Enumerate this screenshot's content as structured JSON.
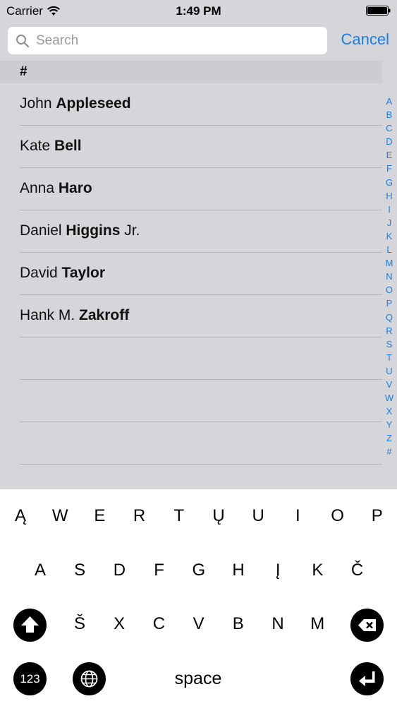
{
  "status_bar": {
    "carrier": "Carrier",
    "time": "1:49 PM",
    "wifi_icon": "wifi-icon",
    "battery_icon": "battery-icon"
  },
  "search": {
    "placeholder": "Search",
    "value": "",
    "cancel_label": "Cancel",
    "icon": "search-icon"
  },
  "section": {
    "header": "#"
  },
  "contacts": [
    {
      "first": "John",
      "last": "Appleseed",
      "suffix": ""
    },
    {
      "first": "Kate",
      "last": "Bell",
      "suffix": ""
    },
    {
      "first": "Anna",
      "last": "Haro",
      "suffix": ""
    },
    {
      "first": "Daniel",
      "last": "Higgins",
      "suffix": "Jr."
    },
    {
      "first": "David",
      "last": "Taylor",
      "suffix": ""
    },
    {
      "first": "Hank M.",
      "last": "Zakroff",
      "suffix": ""
    }
  ],
  "section_index": [
    "A",
    "B",
    "C",
    "D",
    "E",
    "F",
    "G",
    "H",
    "I",
    "J",
    "K",
    "L",
    "M",
    "N",
    "O",
    "P",
    "Q",
    "R",
    "S",
    "T",
    "U",
    "V",
    "W",
    "X",
    "Y",
    "Z",
    "#"
  ],
  "keyboard": {
    "row1": [
      "Ą",
      "W",
      "E",
      "R",
      "T",
      "Ų",
      "U",
      "I",
      "O",
      "P"
    ],
    "row2": [
      "A",
      "S",
      "D",
      "F",
      "G",
      "H",
      "Į",
      "K",
      "Č"
    ],
    "row3": [
      "Š",
      "X",
      "C",
      "V",
      "B",
      "N",
      "M"
    ],
    "numbers_label": "123",
    "space_label": "space",
    "shift_icon": "shift-icon",
    "delete_icon": "delete-icon",
    "globe_icon": "globe-icon",
    "return_icon": "return-icon"
  },
  "colors": {
    "accent": "#1a7ee6",
    "background": "#d6d6da",
    "section_header": "#cdcdd1",
    "separator": "#b5b5ba"
  }
}
